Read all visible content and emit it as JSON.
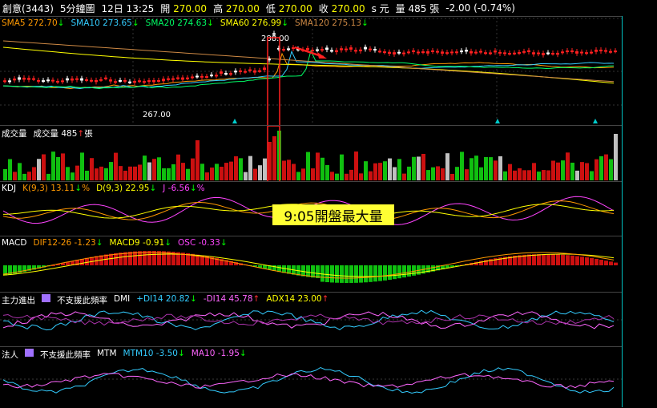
{
  "header": {
    "stock": "創意(3443)",
    "period": "5分鐘圖",
    "datetime": "12日 13:25",
    "open_label": "開",
    "open": "270.00",
    "high_label": "高",
    "high": "270.00",
    "low_label": "低",
    "low": "270.00",
    "close_label": "收",
    "close": "270.00",
    "unit": "s 元",
    "vol_label": "量",
    "vol": "485",
    "vol_unit": "張",
    "change": "-2.00 (-0.74%)"
  },
  "sma": {
    "sma5": "SMA5 272.70",
    "sma10": "SMA10 273.65",
    "sma20": "SMA20 274.63",
    "sma60": "SMA60 276.99",
    "sma120": "SMA120 275.13",
    "colors": {
      "sma5": "#ff9900",
      "sma10": "#33ccff",
      "sma20": "#00ff66",
      "sma60": "#ffff00",
      "sma120": "#cc8844"
    }
  },
  "price_labels": {
    "high_mark": "288.00",
    "low_mark": "267.00"
  },
  "volume": {
    "title": "成交量",
    "label": "成交量 485",
    "unit": "張"
  },
  "kdj": {
    "title": "KDJ",
    "k": "K(9,3) 13.11",
    "d": "D(9,3) 22.95",
    "j": "J -6.56",
    "j_unit": "%",
    "k_unit": "%"
  },
  "macd": {
    "title": "MACD",
    "dif": "DIF12-26 -1.23",
    "macd9": "MACD9 -0.91",
    "osc": "OSC -0.33"
  },
  "dmi": {
    "title": "主力進出",
    "unsupported": "不支援此頻率",
    "name": "DMI",
    "pdi": "+DI14 20.82",
    "mdi": "-DI14 45.78",
    "adx": "ADX14 23.00"
  },
  "mtm": {
    "title": "法人",
    "unsupported": "不支援此頻率",
    "name": "MTM",
    "mtm10": "MTM10 -3.50",
    "ma10": "MA10 -1.95"
  },
  "annotation": "9:05開盤最大量"
}
